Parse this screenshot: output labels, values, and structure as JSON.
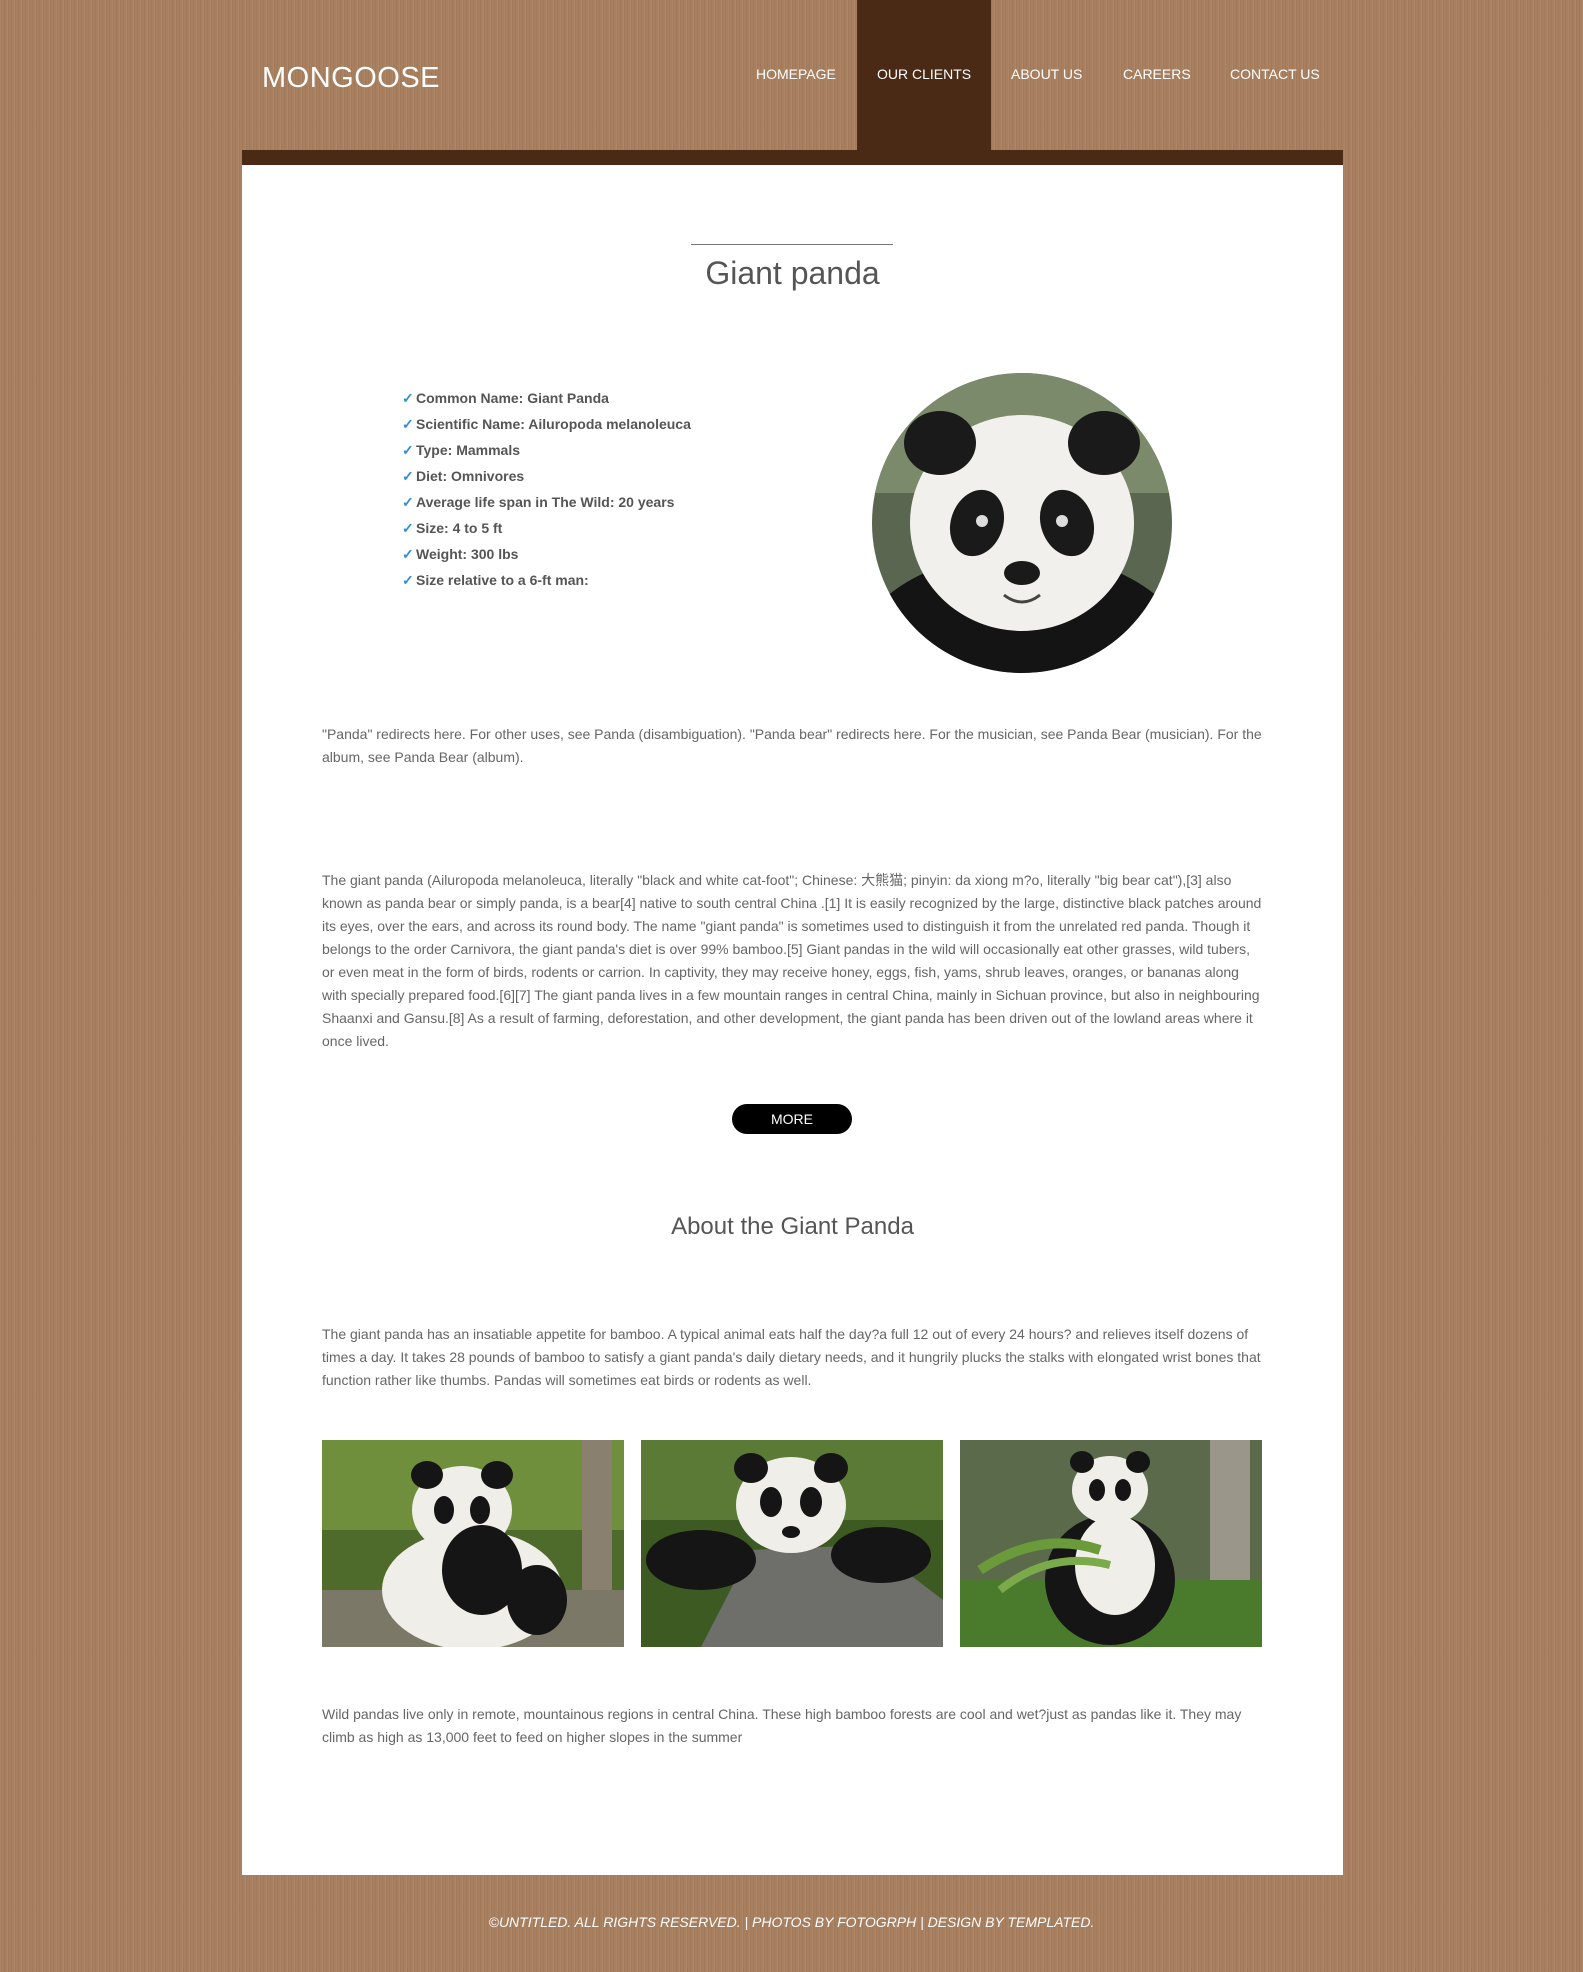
{
  "header": {
    "logo": "MONGOOSE",
    "nav": [
      {
        "label": "HOMEPAGE",
        "active": false
      },
      {
        "label": "OUR CLIENTS",
        "active": true
      },
      {
        "label": "ABOUT US",
        "active": false
      },
      {
        "label": "CAREERS",
        "active": false
      },
      {
        "label": "CONTACT US",
        "active": false
      }
    ]
  },
  "main": {
    "title": "Giant panda",
    "facts": [
      "Common Name: Giant Panda",
      "Scientific Name: Ailuropoda melanoleuca",
      "Type: Mammals",
      "Diet: Omnivores",
      "Average life span in The Wild: 20 years",
      "Size: 4 to 5 ft",
      "Weight: 300 lbs",
      "Size relative to a 6-ft man:"
    ],
    "fact_icon": "check-icon",
    "redirect_note": "\"Panda\" redirects here. For other uses, see Panda (disambiguation). \"Panda bear\" redirects here. For the musician, see Panda Bear (musician). For the album, see Panda Bear (album).",
    "intro": "The giant panda (Ailuropoda melanoleuca, literally \"black and white cat-foot\"; Chinese: 大熊猫; pinyin: da xiong m?o, literally \"big bear cat\"),[3] also known as panda bear or simply panda, is a bear[4] native to south central China .[1] It is easily recognized by the large, distinctive black patches around its eyes, over the ears, and across its round body. The name \"giant panda\" is sometimes used to distinguish it from the unrelated red panda. Though it belongs to the order Carnivora, the giant panda's diet is over 99% bamboo.[5] Giant pandas in the wild will occasionally eat other grasses, wild tubers, or even meat in the form of birds, rodents or carrion. In captivity, they may receive honey, eggs, fish, yams, shrub leaves, oranges, or bananas along with specially prepared food.[6][7] The giant panda lives in a few mountain ranges in central China, mainly in Sichuan province, but also in neighbouring Shaanxi and Gansu.[8] As a result of farming, deforestation, and other development, the giant panda has been driven out of the lowland areas where it once lived.",
    "more_label": "MORE",
    "about_title": "About the Giant Panda",
    "about_text": "The giant panda has an insatiable appetite for bamboo. A typical animal eats half the day?a full 12 out of every 24 hours? and relieves itself dozens of times a day. It takes 28 pounds of bamboo to satisfy a giant panda's daily dietary needs, and it hungrily plucks the stalks with elongated wrist bones that function rather like thumbs. Pandas will sometimes eat birds or rodents as well.",
    "closing_text": "Wild pandas live only in remote, mountainous regions in central China. These high bamboo forests are cool and wet?just as pandas like it. They may climb as high as 13,000 feet to feed on higher slopes in the summer"
  },
  "footer": {
    "text": "©UNTITLED. ALL RIGHTS RESERVED. | PHOTOS BY FOTOGRPH | DESIGN BY TEMPLATED."
  },
  "colors": {
    "background": "#a8805f",
    "accent_dark": "#4a2a14",
    "check": "#2f8fcf",
    "button": "#000000"
  }
}
